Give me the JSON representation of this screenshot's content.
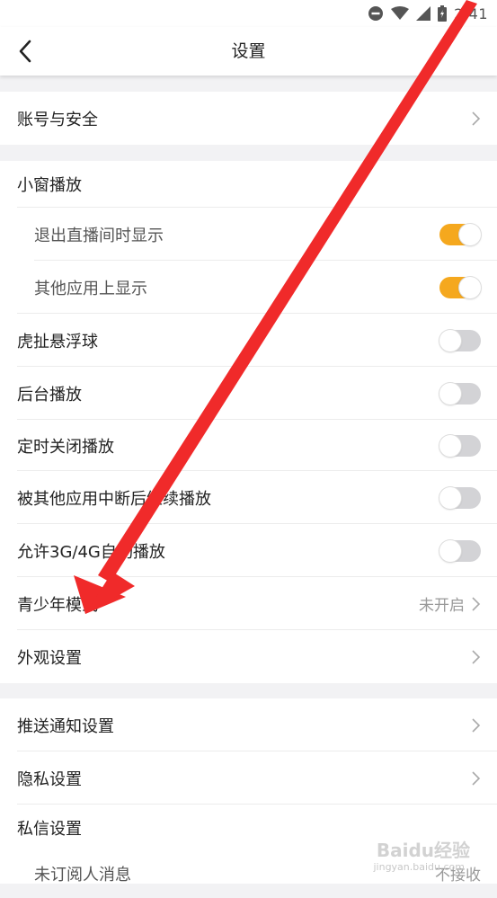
{
  "status_bar": {
    "time": "2:41"
  },
  "header": {
    "title": "设置"
  },
  "groups": {
    "account": {
      "label": "账号与安全"
    },
    "playback": {
      "small_window": "小窗播放",
      "exit_live_show": "退出直播间时显示",
      "other_apps_show": "其他应用上显示",
      "floating_ball": "虎扯悬浮球",
      "background_play": "后台播放",
      "timer_close": "定时关闭播放",
      "resume_after_interrupt": "被其他应用中断后继续播放",
      "allow_mobile_autoplay": "允许3G/4G自动播放",
      "teen_mode": "青少年模式",
      "teen_mode_value": "未开启",
      "appearance": "外观设置"
    },
    "privacy": {
      "push": "推送通知设置",
      "privacy": "隐私设置",
      "message": "私信设置",
      "stranger_msg": "未订阅人消息",
      "stranger_msg_value": "不接收"
    }
  },
  "toggles": {
    "exit_live_show": true,
    "other_apps_show": true,
    "floating_ball": false,
    "background_play": false,
    "timer_close": false,
    "resume_after_interrupt": false,
    "allow_mobile_autoplay": false
  },
  "colors": {
    "accent": "#f5a81e",
    "annotation_arrow": "#f02a2a",
    "toggle_off": "#d3d3d6"
  },
  "watermark": {
    "text": "Baidu经验",
    "sub": "jingyan.baidu.com"
  }
}
